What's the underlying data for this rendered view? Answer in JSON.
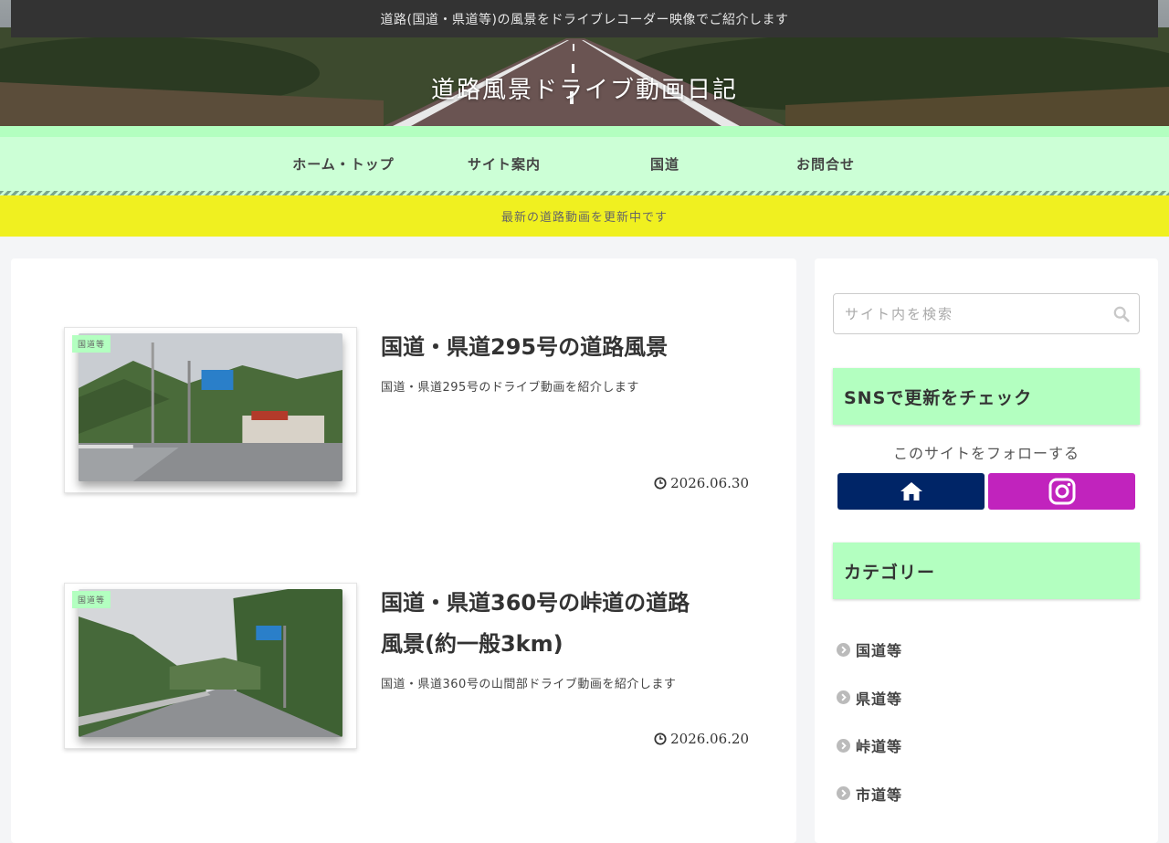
{
  "header": {
    "tagline": "道路(国道・県道等)の風景をドライブレコーダー映像でご紹介します",
    "site_title": "道路風景ドライブ動画日記"
  },
  "nav": {
    "items": [
      {
        "label": "ホーム・トップ"
      },
      {
        "label": "サイト案内"
      },
      {
        "label": "国道"
      },
      {
        "label": "お問合せ"
      }
    ]
  },
  "notice": "最新の道路動画を更新中です",
  "posts": [
    {
      "category": "国道等",
      "title": "国道・県道295号の道路風景",
      "snippet": "国道・県道295号のドライブ動画を紹介します",
      "date": "2026.06.30"
    },
    {
      "category": "国道等",
      "title": "国道・県道360号の峠道の道路風景(約一般3km)",
      "snippet": "国道・県道360号の山間部ドライブ動画を紹介します",
      "date": "2026.06.20"
    }
  ],
  "sidebar": {
    "search_placeholder": "サイト内を検索",
    "sns_title": "SNSで更新をチェック",
    "follow_label": "このサイトをフォローする",
    "category_title": "カテゴリー",
    "categories": [
      {
        "label": "国道等"
      },
      {
        "label": "県道等"
      },
      {
        "label": "峠道等"
      },
      {
        "label": "市道等"
      }
    ]
  },
  "colors": {
    "accent_green": "#b3ffc0",
    "nav_bg": "#ccffd6",
    "notice_bg": "#f0f020",
    "home_btn": "#002567",
    "instagram_btn": "#c123bd"
  }
}
